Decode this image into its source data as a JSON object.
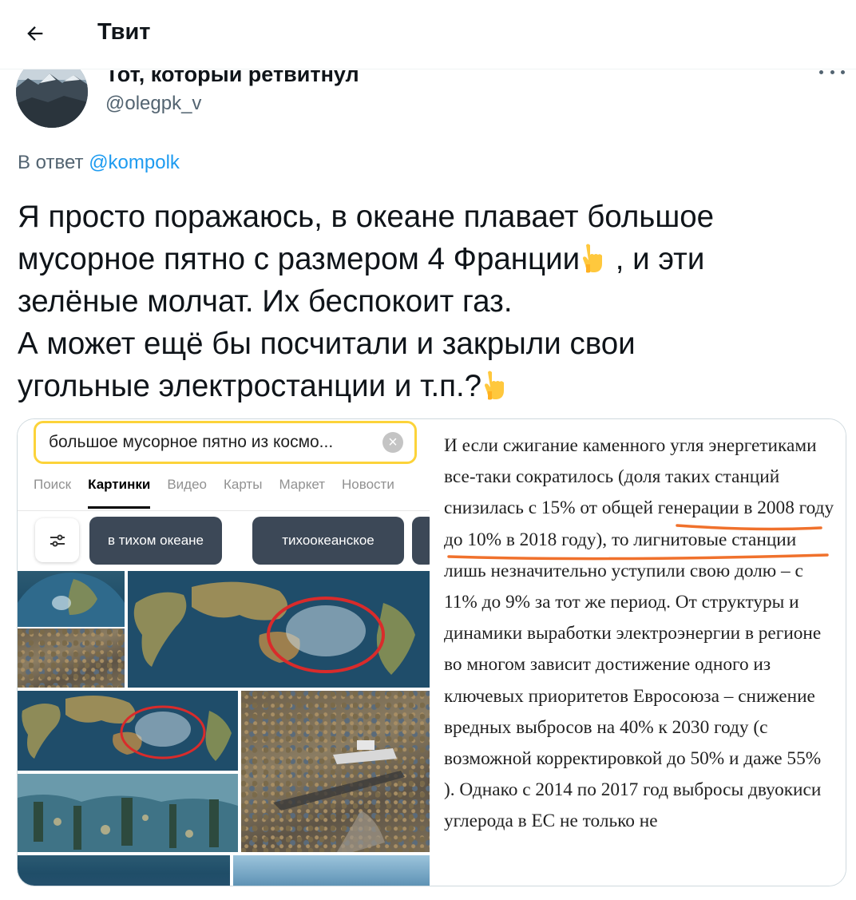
{
  "header": {
    "title": "Твит"
  },
  "author": {
    "name": "Тот, который ретвитнул",
    "handle": "@olegpk_v"
  },
  "reply": {
    "prefix": "В ответ",
    "mention": "@kompolk"
  },
  "tweet": {
    "line1": "Я просто поражаюсь, в океане плавает большое",
    "line2a": "мусорное пятно с размером 4 Франции",
    "line2b": " , и эти",
    "line3": "зелёные молчат. Их беспокоит газ.",
    "line4": "А может ещё бы посчитали и закрыли свои",
    "line5": "угольные электростанции и т.п.?",
    "emoji": "pointing-down-icon"
  },
  "media": {
    "search": {
      "query": "большое мусорное пятно из космо...",
      "tabs": [
        "Поиск",
        "Картинки",
        "Видео",
        "Карты",
        "Маркет",
        "Новости"
      ],
      "active_tab": "Картинки",
      "chips": [
        "в тихом океане",
        "тихоокеанское"
      ]
    },
    "article_text": "И если сжигание каменного угля энергетиками все-таки сократилось (доля таких станций снизилась с 15% от общей генерации в 2008 году до 10% в 2018 году), то лигнитовые станции лишь незначительно уступили свою долю – с 11% до 9% за тот же период. От структуры и динамики выработки электроэнергии в регионе во многом зависит достижение одного из ключевых приоритетов Евросоюза – снижение вредных выбросов на 40% к 2030 году (с возможной корректировкой до 50% и даже 55% ). Однако с 2014 по 2017 год выбросы двуокиси углерода в ЕС не только не"
  },
  "colors": {
    "accent": "#1d9bf0",
    "underline": "#f0712c",
    "search_border": "#fcd33a",
    "chip_bg": "#3c4857"
  }
}
